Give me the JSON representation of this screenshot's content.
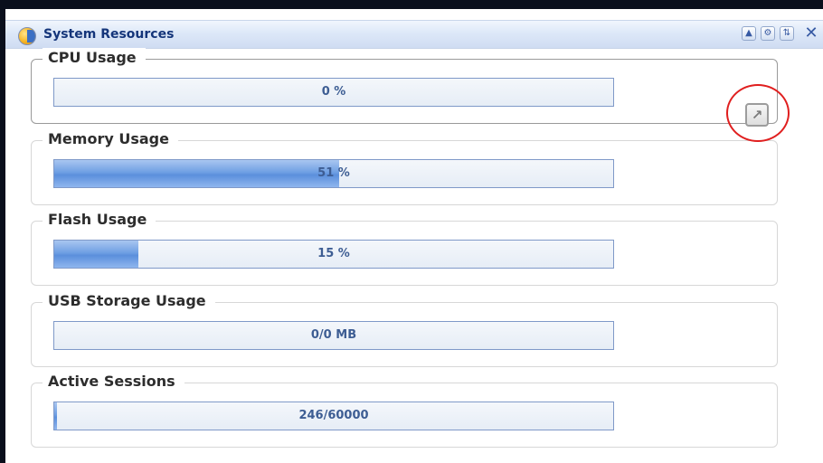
{
  "window": {
    "title": "System Resources",
    "icon": "dashboard-globe-icon",
    "buttons": [
      {
        "name": "collapse-button",
        "icon": "triangle-up-icon",
        "glyph": "▲"
      },
      {
        "name": "settings-button",
        "icon": "gear-icon",
        "glyph": "⚙"
      },
      {
        "name": "refresh-button",
        "icon": "refresh-icon",
        "glyph": "⇅"
      }
    ],
    "close": {
      "icon": "close-icon",
      "glyph": "✕"
    }
  },
  "expand": {
    "icon": "expand-arrow-icon",
    "glyph": "↗",
    "highlight_color": "#e01f1f"
  },
  "panels": [
    {
      "title": "CPU Usage",
      "label": "0 %",
      "fill_percent": 0
    },
    {
      "title": "Memory Usage",
      "label": "51 %",
      "fill_percent": 51
    },
    {
      "title": "Flash Usage",
      "label": "15 %",
      "fill_percent": 15
    },
    {
      "title": "USB Storage Usage",
      "label": "0/0 MB",
      "fill_percent": 0
    },
    {
      "title": "Active Sessions",
      "label": "246/60000",
      "fill_percent": 0.41
    }
  ],
  "colors": {
    "title_text": "#14357a",
    "bar_fill": "#6f9fe3",
    "bar_border": "#7f99c8",
    "bar_text": "#3d5d93"
  }
}
